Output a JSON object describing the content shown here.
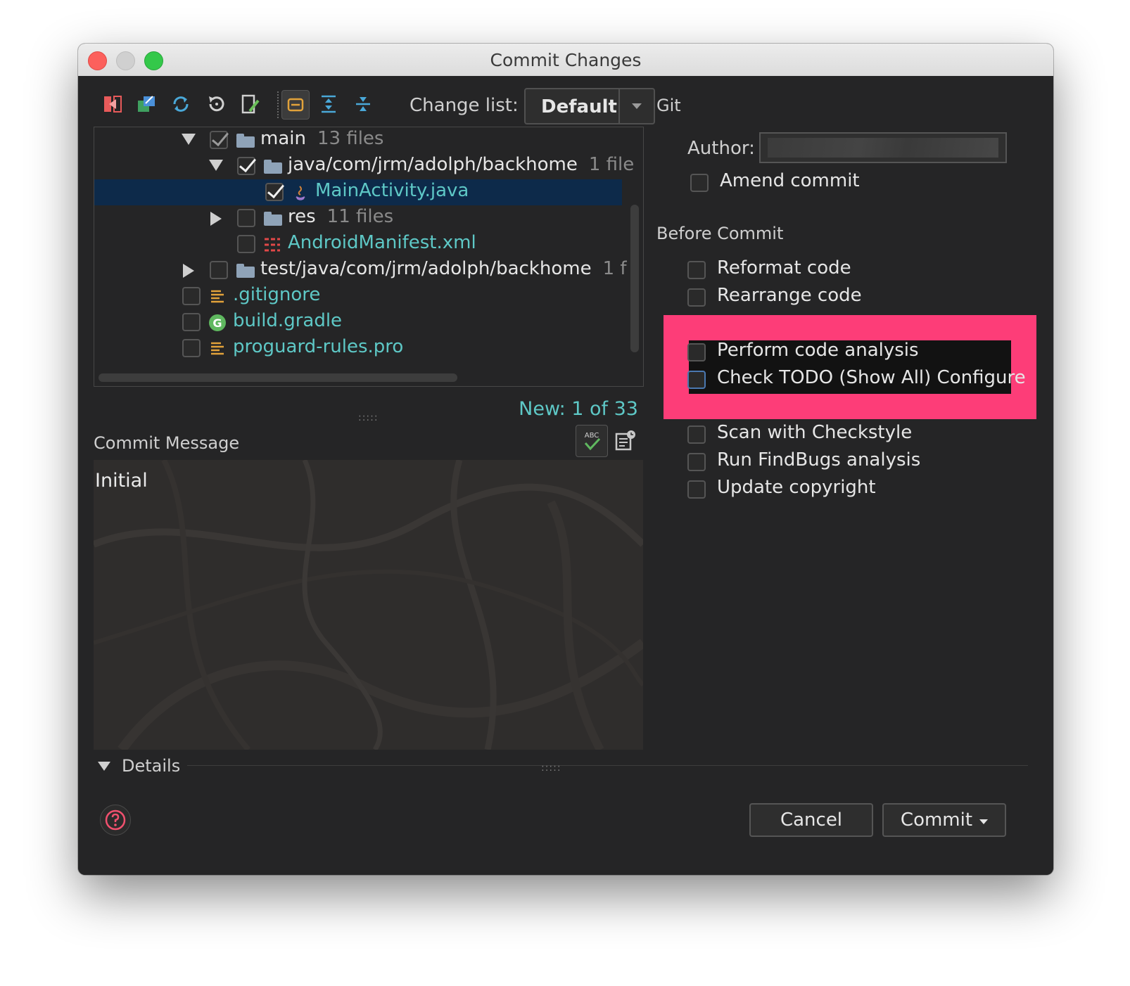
{
  "window": {
    "title": "Commit Changes"
  },
  "toolbar": {
    "buttons": [
      "show-diff-icon",
      "move-to-changelist-icon",
      "refresh-icon",
      "rollback-icon",
      "edit-source-icon",
      "group-by-icon",
      "expand-all-icon",
      "collapse-all-icon"
    ],
    "changelist_label": "Change list:",
    "changelist_value": "Default"
  },
  "tree": {
    "rows": [
      {
        "name": "main",
        "count": "13 files",
        "checked": true
      },
      {
        "name": "java/com/jrm/adolph/backhome",
        "count": "1 file",
        "checked": true
      },
      {
        "name": "MainActivity.java",
        "checked": true,
        "selected": true
      },
      {
        "name": "res",
        "count": "11 files",
        "checked": false
      },
      {
        "name": "AndroidManifest.xml",
        "checked": false
      },
      {
        "name": "test/java/com/jrm/adolph/backhome",
        "count": "1 f",
        "checked": false
      },
      {
        "name": ".gitignore",
        "checked": false
      },
      {
        "name": "build.gradle",
        "checked": false
      },
      {
        "name": "proguard-rules.pro",
        "checked": false
      }
    ]
  },
  "status": {
    "new_count": "New: 1 of 33"
  },
  "commit_message": {
    "label": "Commit Message",
    "text": "Initial"
  },
  "git": {
    "label": "Git",
    "author_label": "Author:",
    "amend": "Amend commit"
  },
  "before_commit": {
    "label": "Before Commit",
    "options": [
      "Reformat code",
      "Rearrange code",
      "Perform code analysis",
      "Check TODO (Show All) Configure",
      "Scan with Checkstyle",
      "Run FindBugs analysis",
      "Update copyright"
    ]
  },
  "details": {
    "label": "Details"
  },
  "buttons": {
    "cancel": "Cancel",
    "commit": "Commit"
  },
  "colors": {
    "accent_teal": "#5ec8c6",
    "highlight": "#fd3d78",
    "selection": "#0d2a4a"
  }
}
